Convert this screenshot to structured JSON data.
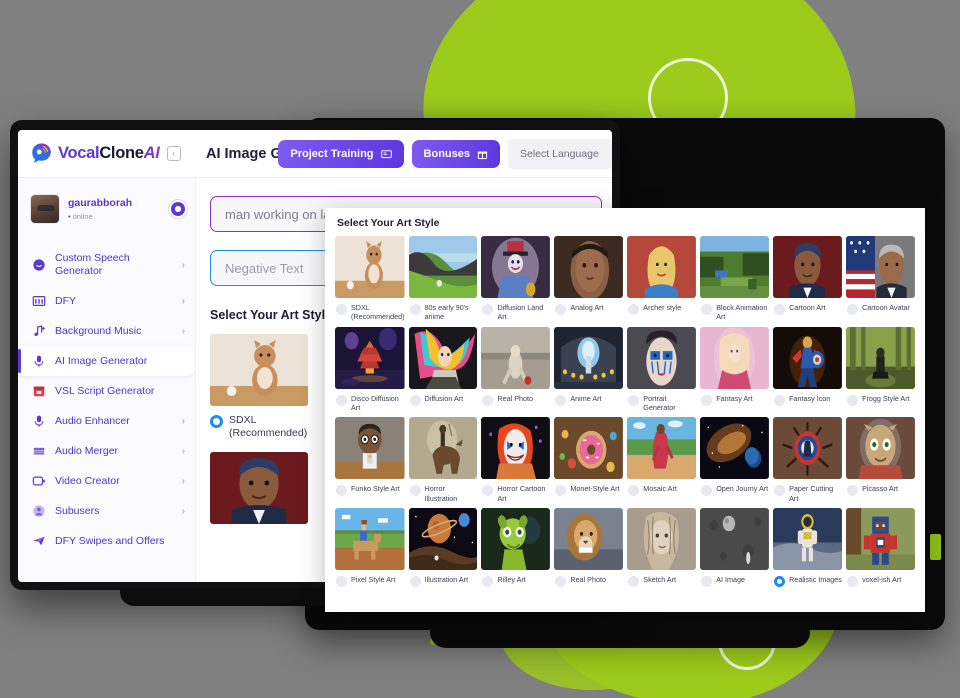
{
  "brand": {
    "name_part1": "Vocal",
    "name_part2": "Clone",
    "name_part3": "AI",
    "collapse_glyph": "‹"
  },
  "header": {
    "page_title": "AI Image Generator",
    "project_training_label": "Project Training",
    "bonuses_label": "Bonuses",
    "language_selector_value": "Select Language"
  },
  "user": {
    "name": "gaurabborah",
    "status": "online"
  },
  "sidebar": {
    "items": [
      {
        "label": "Custom Speech Generator",
        "icon": "speech-bubble-icon",
        "chevron": "›",
        "active": false
      },
      {
        "label": "DFY",
        "icon": "grid-icon",
        "chevron": "›",
        "active": false
      },
      {
        "label": "Background Music",
        "icon": "music-note-icon",
        "chevron": "›",
        "active": false
      },
      {
        "label": "AI Image Generator",
        "icon": "microphone-icon",
        "chevron": "",
        "active": true
      },
      {
        "label": "VSL Script Generator",
        "icon": "calendar-icon",
        "chevron": "",
        "active": false
      },
      {
        "label": "Audio Enhancer",
        "icon": "microphone-icon",
        "chevron": "›",
        "active": false
      },
      {
        "label": "Audio Merger",
        "icon": "layers-icon",
        "chevron": "›",
        "active": false
      },
      {
        "label": "Video Creator",
        "icon": "video-icon",
        "chevron": "›",
        "active": false
      },
      {
        "label": "Subusers",
        "icon": "user-circle-icon",
        "chevron": "›",
        "active": false
      },
      {
        "label": "DFY Swipes and Offers",
        "icon": "send-icon",
        "chevron": "",
        "active": false
      }
    ]
  },
  "main": {
    "prompt_value": "man working on laptop, frustrated, at night, bills on desk",
    "negative_placeholder": "Negative Text",
    "art_style_heading": "Select Your Art Style",
    "background_styles": [
      {
        "label": "SDXL (Recommended)",
        "selected": true,
        "art": "cat"
      },
      {
        "label": "",
        "selected": false,
        "art": "obama"
      }
    ]
  },
  "modal": {
    "title": "Select Your Art Style",
    "styles": [
      {
        "label": "SDXL (Recommended)",
        "selected": false,
        "art": "cat"
      },
      {
        "label": "80s early 90's anime",
        "selected": false,
        "art": "valley"
      },
      {
        "label": "Diffusion Land Art",
        "selected": false,
        "art": "clown"
      },
      {
        "label": "Analog Art",
        "selected": false,
        "art": "portrait-warm"
      },
      {
        "label": "Archer style",
        "selected": false,
        "art": "archer"
      },
      {
        "label": "Block Animation Art",
        "selected": false,
        "art": "minecraft"
      },
      {
        "label": "Cartoon Art",
        "selected": false,
        "art": "obama-cartoon"
      },
      {
        "label": "Cartoon Avatar",
        "selected": false,
        "art": "obama-flag"
      },
      {
        "label": "Disco Diffusion Art",
        "selected": false,
        "art": "pagoda"
      },
      {
        "label": "Diffusion Art",
        "selected": false,
        "art": "rainbow-hair"
      },
      {
        "label": "Real Photo",
        "selected": false,
        "art": "kid-ball"
      },
      {
        "label": "Anime Art",
        "selected": false,
        "art": "hall"
      },
      {
        "label": "Portrait Generator",
        "selected": false,
        "art": "blue-makeup"
      },
      {
        "label": "Fantasy Art",
        "selected": false,
        "art": "pink-fantasy"
      },
      {
        "label": "Fantasy Icon",
        "selected": false,
        "art": "hero"
      },
      {
        "label": "Frogg Style Art",
        "selected": false,
        "art": "forest-rider"
      },
      {
        "label": "Funko Style Art",
        "selected": false,
        "art": "funko"
      },
      {
        "label": "Horror Illustration",
        "selected": false,
        "art": "horse-rider"
      },
      {
        "label": "Horror Cartoon Art",
        "selected": false,
        "art": "creepy-clown"
      },
      {
        "label": "Monet-Style Art",
        "selected": false,
        "art": "donut"
      },
      {
        "label": "Mosaic Art",
        "selected": false,
        "art": "mosaic-woman"
      },
      {
        "label": "Open Journy Art",
        "selected": false,
        "art": "space"
      },
      {
        "label": "Paper Cutting Art",
        "selected": false,
        "art": "emblem"
      },
      {
        "label": "Picasso Art",
        "selected": false,
        "art": "alien-helmet"
      },
      {
        "label": "Pixel Style Art",
        "selected": false,
        "art": "pixel-horse"
      },
      {
        "label": "Illustration Art",
        "selected": false,
        "art": "planet"
      },
      {
        "label": "Rilley Art",
        "selected": false,
        "art": "green-creature"
      },
      {
        "label": "Real Photo",
        "selected": false,
        "art": "lion"
      },
      {
        "label": "Sketch Art",
        "selected": false,
        "art": "sketch-face"
      },
      {
        "label": "AI Image",
        "selected": false,
        "art": "moon"
      },
      {
        "label": "Realistic Images",
        "selected": true,
        "art": "astronaut"
      },
      {
        "label": "voxel-ish Art",
        "selected": false,
        "art": "voxel-hero"
      }
    ]
  },
  "colors": {
    "brand_purple": "#5b37d6",
    "accent_blue": "#1d8bf1",
    "accent_green": "#9ccb1c",
    "prompt_border": "#8b2fd6"
  }
}
